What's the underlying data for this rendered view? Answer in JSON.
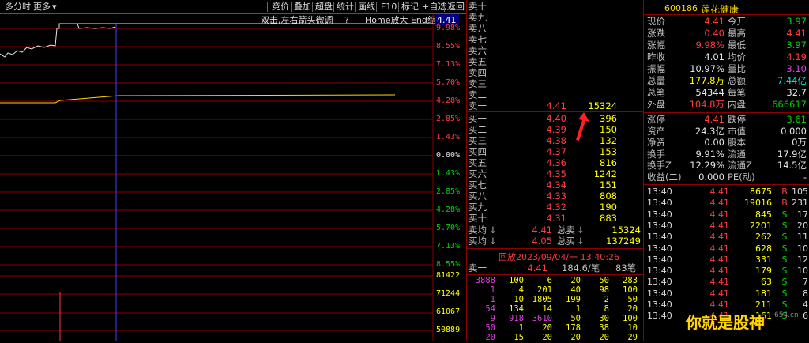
{
  "toolbar": {
    "left_items": [
      "多分时",
      "更多"
    ],
    "right_items": [
      "竞价",
      "叠加",
      "超盘",
      "统计",
      "画线",
      "F10",
      "标记",
      "+自选",
      "返回"
    ]
  },
  "subbar": {
    "hint": "双击,左右箭头微调",
    "question": "?",
    "zoom_hint": "Home放大 End缩小",
    "current_price": "4.41"
  },
  "pct_labels": {
    "upper": [
      "9.98%",
      "8.55%",
      "7.13%",
      "5.70%",
      "4.28%",
      "2.85%",
      "1.43%",
      "0.00%"
    ],
    "lower": [
      "1.43%",
      "2.85%",
      "4.28%",
      "5.70%",
      "7.13%",
      "8.55%"
    ],
    "volumes": [
      "81422",
      "71244",
      "61067",
      "50889"
    ]
  },
  "colors": {
    "up": "#ff3c3c",
    "down": "#00d200",
    "flat": "#e6e6e6",
    "volume": "#ffff00",
    "grid": "#8b0000",
    "cursor": "#4040ff"
  },
  "book": {
    "asks": [
      {
        "label": "卖十",
        "price": "",
        "vol": ""
      },
      {
        "label": "卖九",
        "price": "",
        "vol": ""
      },
      {
        "label": "卖八",
        "price": "",
        "vol": ""
      },
      {
        "label": "卖七",
        "price": "",
        "vol": ""
      },
      {
        "label": "卖六",
        "price": "",
        "vol": ""
      },
      {
        "label": "卖五",
        "price": "",
        "vol": ""
      },
      {
        "label": "卖四",
        "price": "",
        "vol": ""
      },
      {
        "label": "卖三",
        "price": "",
        "vol": ""
      },
      {
        "label": "卖二",
        "price": "",
        "vol": ""
      },
      {
        "label": "卖一",
        "price": "4.41",
        "vol": "15324"
      }
    ],
    "bids": [
      {
        "label": "买一",
        "price": "4.40",
        "vol": "396"
      },
      {
        "label": "买二",
        "price": "4.39",
        "vol": "150"
      },
      {
        "label": "买三",
        "price": "4.38",
        "vol": "132"
      },
      {
        "label": "买四",
        "price": "4.37",
        "vol": "153"
      },
      {
        "label": "买五",
        "price": "4.36",
        "vol": "816"
      },
      {
        "label": "买六",
        "price": "4.35",
        "vol": "1242"
      },
      {
        "label": "买七",
        "price": "4.34",
        "vol": "151"
      },
      {
        "label": "买八",
        "price": "4.33",
        "vol": "808"
      },
      {
        "label": "买九",
        "price": "4.32",
        "vol": "190"
      },
      {
        "label": "买十",
        "price": "4.31",
        "vol": "883"
      }
    ],
    "avg_sell_label": "卖均",
    "avg_sell": "4.41",
    "total_sell_label": "总卖",
    "total_sell": "15324",
    "avg_buy_label": "买均",
    "avg_buy": "4.05",
    "total_buy_label": "总买",
    "total_buy": "137249",
    "replay": "回放2023/09/04/一 13:40:26",
    "level_label": "卖一",
    "level_price": "4.41",
    "level_avg": "184.6/笔",
    "level_count": "83笔",
    "detail": [
      [
        "3888",
        "100",
        "6",
        "20",
        "50",
        "283"
      ],
      [
        "1",
        "4",
        "201",
        "40",
        "98",
        "100"
      ],
      [
        "1",
        "10",
        "1805",
        "199",
        "2",
        "50"
      ],
      [
        "54",
        "134",
        "14",
        "1",
        "8",
        "20"
      ],
      [
        "9",
        "918",
        "3610",
        "50",
        "30",
        "100"
      ],
      [
        "50",
        "1",
        "20",
        "178",
        "38",
        "10"
      ],
      [
        "20",
        "15",
        "20",
        "20",
        "20",
        "29"
      ]
    ]
  },
  "stock": {
    "code": "600186",
    "name": "莲花健康"
  },
  "quote": [
    {
      "k1": "现价",
      "v1": "4.41",
      "k2": "今开",
      "v2": "3.97",
      "c1": "red",
      "c2": "green"
    },
    {
      "k1": "涨跌",
      "v1": "0.40",
      "k2": "最高",
      "v2": "4.41",
      "c1": "red",
      "c2": "red"
    },
    {
      "k1": "涨幅",
      "v1": "9.98%",
      "k2": "最低",
      "v2": "3.97",
      "c1": "red",
      "c2": "green"
    },
    {
      "k1": "昨收",
      "v1": "4.01",
      "k2": "均价",
      "v2": "4.19",
      "c1": "white",
      "c2": "red"
    },
    {
      "k1": "振幅",
      "v1": "10.97%",
      "k2": "量比",
      "v2": "3.10",
      "c1": "white",
      "c2": "mag"
    },
    {
      "k1": "总量",
      "v1": "177.8万",
      "k2": "总额",
      "v2": "7.44亿",
      "c1": "yellow",
      "c2": "cyan"
    },
    {
      "k1": "总笔",
      "v1": "54344",
      "k2": "每笔",
      "v2": "32.7",
      "c1": "white",
      "c2": "white"
    },
    {
      "k1": "外盘",
      "v1": "104.8万",
      "k2": "内盘",
      "v2": "666617",
      "c1": "red",
      "c2": "green"
    }
  ],
  "fund": [
    {
      "k1": "涨停",
      "v1": "4.41",
      "k2": "跌停",
      "v2": "3.61",
      "c1": "red",
      "c2": "green"
    },
    {
      "k1": "资产",
      "v1": "24.3亿",
      "k2": "市值",
      "v2": "0.000",
      "c1": "white",
      "c2": "white"
    },
    {
      "k1": "净资",
      "v1": "0.00",
      "k2": "股本",
      "v2": "0万",
      "c1": "white",
      "c2": "white"
    },
    {
      "k1": "换手",
      "v1": "9.91%",
      "k2": "流通",
      "v2": "17.9亿",
      "c1": "white",
      "c2": "white"
    },
    {
      "k1": "换手Z",
      "v1": "12.29%",
      "k2": "流通Z",
      "v2": "14.5亿",
      "c1": "white",
      "c2": "white"
    },
    {
      "k1": "收益(二)",
      "v1": "0.000",
      "k2": "PE(动)",
      "v2": "-",
      "c1": "white",
      "c2": "white"
    }
  ],
  "ticks": [
    {
      "t": "13:40",
      "p": "4.41",
      "v": "8675",
      "s": "B",
      "n": "105"
    },
    {
      "t": "13:40",
      "p": "4.41",
      "v": "19016",
      "s": "B",
      "n": "231"
    },
    {
      "t": "13:40",
      "p": "4.41",
      "v": "845",
      "s": "S",
      "n": "17"
    },
    {
      "t": "13:40",
      "p": "4.41",
      "v": "2201",
      "s": "S",
      "n": "20"
    },
    {
      "t": "13:40",
      "p": "4.41",
      "v": "262",
      "s": "S",
      "n": "11"
    },
    {
      "t": "13:40",
      "p": "4.41",
      "v": "628",
      "s": "S",
      "n": "10"
    },
    {
      "t": "13:40",
      "p": "4.41",
      "v": "331",
      "s": "S",
      "n": "12"
    },
    {
      "t": "13:40",
      "p": "4.41",
      "v": "179",
      "s": "S",
      "n": "10"
    },
    {
      "t": "13:40",
      "p": "4.41",
      "v": "63",
      "s": "S",
      "n": "7"
    },
    {
      "t": "13:40",
      "p": "4.41",
      "v": "181",
      "s": "S",
      "n": "8"
    },
    {
      "t": "13:40",
      "p": "4.41",
      "v": "211",
      "s": "S",
      "n": "4"
    },
    {
      "t": "13:40",
      "p": "4.41",
      "v": "161",
      "s": "S",
      "n": "6"
    }
  ],
  "watermark": {
    "text": "你就是股神",
    "site": "654.cn"
  }
}
